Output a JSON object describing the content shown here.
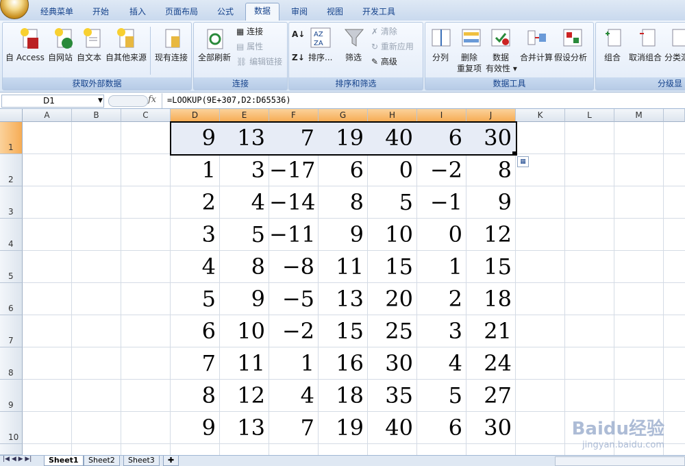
{
  "menu_tabs": [
    "经典菜单",
    "开始",
    "插入",
    "页面布局",
    "公式",
    "数据",
    "审阅",
    "视图",
    "开发工具"
  ],
  "active_tab": "数据",
  "ribbon": {
    "groups": [
      {
        "label": "获取外部数据",
        "buttons": [
          "自 Access",
          "自网站",
          "自文本",
          "自其他来源",
          "现有连接"
        ]
      },
      {
        "label": "连接",
        "buttons": [
          "全部刷新"
        ],
        "small": [
          "连接",
          "属性",
          "编辑链接"
        ]
      },
      {
        "label": "排序和筛选",
        "buttons": [
          "排序...",
          "筛选"
        ],
        "small": [
          "清除",
          "重新应用",
          "高级"
        ]
      },
      {
        "label": "数据工具",
        "buttons": [
          "分列",
          "删除",
          "重复项",
          "数据",
          "有效性 ▾",
          "合并计算",
          "假设分析"
        ]
      },
      {
        "label": "分级显",
        "buttons": [
          "组合",
          "取消组合",
          "分类汇"
        ]
      }
    ]
  },
  "formula_bar": {
    "name_box": "D1",
    "fx": "fx",
    "formula": "=LOOKUP(9E+307,D2:D65536)"
  },
  "columns": [
    "A",
    "B",
    "C",
    "D",
    "E",
    "F",
    "G",
    "H",
    "I",
    "J",
    "K",
    "L",
    "M"
  ],
  "rows": [
    "1",
    "2",
    "3",
    "4",
    "5",
    "6",
    "7",
    "8",
    "9",
    "10"
  ],
  "table": [
    [
      "9",
      "13",
      "7",
      "19",
      "40",
      "6",
      "30"
    ],
    [
      "1",
      "3",
      "−17",
      "6",
      "0",
      "−2",
      "8"
    ],
    [
      "2",
      "4",
      "−14",
      "8",
      "5",
      "−1",
      "9"
    ],
    [
      "3",
      "5",
      "−11",
      "9",
      "10",
      "0",
      "12"
    ],
    [
      "4",
      "8",
      "−8",
      "11",
      "15",
      "1",
      "15"
    ],
    [
      "5",
      "9",
      "−5",
      "13",
      "20",
      "2",
      "18"
    ],
    [
      "6",
      "10",
      "−2",
      "15",
      "25",
      "3",
      "21"
    ],
    [
      "7",
      "11",
      "1",
      "16",
      "30",
      "4",
      "24"
    ],
    [
      "8",
      "12",
      "4",
      "18",
      "35",
      "5",
      "27"
    ],
    [
      "9",
      "13",
      "7",
      "19",
      "40",
      "6",
      "30"
    ]
  ],
  "sheets": [
    "Sheet1",
    "Sheet2",
    "Sheet3"
  ],
  "watermark": {
    "brand": "Baidu经验",
    "url": "jingyan.baidu.com"
  },
  "colors": {
    "accent": "#15428b",
    "selection": "#f6ac55"
  }
}
